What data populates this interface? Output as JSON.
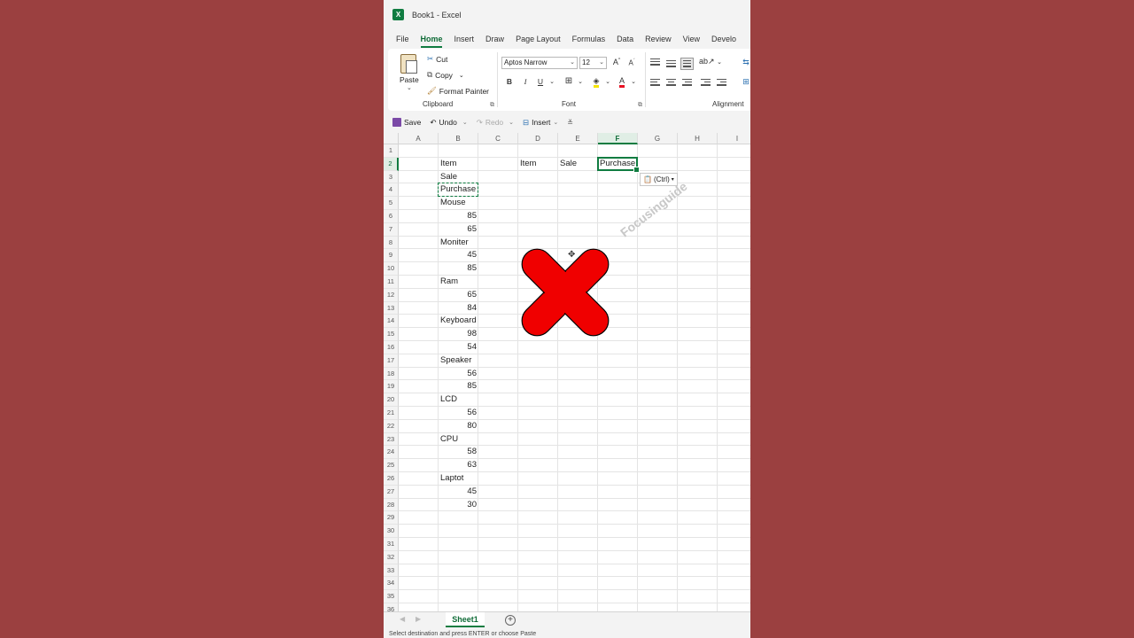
{
  "app": {
    "title": "Book1 - Excel",
    "accent": "#107c41",
    "background": "#9b4040",
    "watermark": "Focusinguide"
  },
  "menu": {
    "tabs": [
      "File",
      "Home",
      "Insert",
      "Draw",
      "Page Layout",
      "Formulas",
      "Data",
      "Review",
      "View",
      "Develo"
    ],
    "active": "Home"
  },
  "ribbon": {
    "clipboard": {
      "label": "Clipboard",
      "paste": "Paste",
      "cut": "Cut",
      "copy": "Copy",
      "format_painter": "Format Painter"
    },
    "font": {
      "label": "Font",
      "name": "Aptos Narrow",
      "size": "12",
      "bold": "B",
      "italic": "I",
      "underline": "U"
    },
    "alignment": {
      "label": "Alignment"
    }
  },
  "qat": {
    "save": "Save",
    "undo": "Undo",
    "redo": "Redo",
    "insert": "Insert"
  },
  "grid": {
    "columns": [
      "A",
      "B",
      "C",
      "D",
      "E",
      "F",
      "G",
      "H",
      "I"
    ],
    "selected_column": "F",
    "selected_row": 2,
    "rows": 36,
    "cells": {
      "B2": "Item",
      "B3": "Sale",
      "B4": "Purchase",
      "B5": "Mouse",
      "B6": "85",
      "B7": "65",
      "B8": "Moniter",
      "B9": "45",
      "B10": "85",
      "B11": "Ram",
      "B12": "65",
      "B13": "84",
      "B14": "Keyboard",
      "B15": "98",
      "B16": "54",
      "B17": "Speaker",
      "B18": "56",
      "B19": "85",
      "B20": "LCD",
      "B21": "56",
      "B22": "80",
      "B23": "CPU",
      "B24": "58",
      "B25": "63",
      "B26": "Laptot",
      "B27": "45",
      "B28": "30",
      "D2": "Item",
      "E2": "Sale",
      "F2": "Purchase"
    },
    "paste_options": "(Ctrl)",
    "overlay_icon": "red-x-icon"
  },
  "sheets": {
    "tabs": [
      "Sheet1"
    ],
    "active": "Sheet1"
  },
  "status": {
    "message": "Select destination and press ENTER or choose Paste"
  }
}
